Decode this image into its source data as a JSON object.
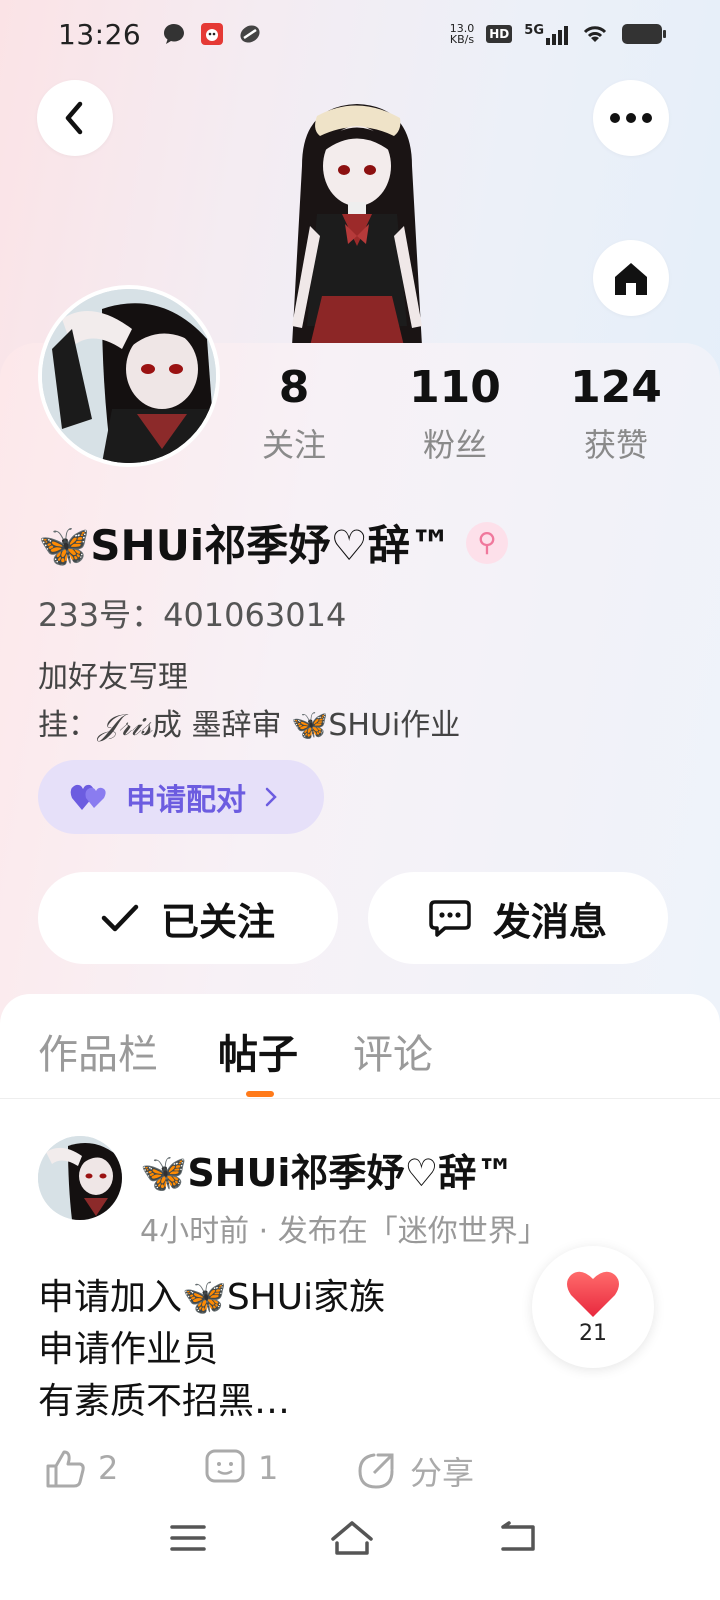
{
  "status_bar": {
    "time": "13:26",
    "net_speed_value": "13.0",
    "net_speed_unit": "KB/s",
    "hd_label": "HD",
    "network_label": "5G"
  },
  "header": {
    "back_icon": "chevron-left-icon",
    "more_icon": "more-dots-icon",
    "home_icon": "home-icon"
  },
  "profile": {
    "stats": [
      {
        "value": "8",
        "label": "关注"
      },
      {
        "value": "110",
        "label": "粉丝"
      },
      {
        "value": "124",
        "label": "获赞"
      }
    ],
    "nickname": "🦋SHUi祁季妤♡辞™",
    "gender_symbol": "⚲",
    "uid": "233号：401063014",
    "bio_line1": "加好友写理",
    "bio_line2_prefix": "挂：",
    "bio_line2_iris": "𝒥𝓇𝒾𝓈",
    "bio_line2_rest": "成 墨辞审 🦋SHUi作业",
    "pair_button": "申请配对",
    "follow_button": "已关注",
    "message_button": "发消息"
  },
  "tabs": [
    {
      "label": "作品栏",
      "active": false
    },
    {
      "label": "帖子",
      "active": true
    },
    {
      "label": "评论",
      "active": false
    }
  ],
  "post": {
    "author": "🦋SHUi祁季妤♡辞™",
    "meta": "4小时前 · 发布在「迷你世界」",
    "body_lines": [
      "申请加入🦋SHUi家族",
      "申请作业员",
      "有素质不招黑…"
    ],
    "like_float_count": "21",
    "actions": {
      "likes": "2",
      "comments": "1",
      "share": "分享"
    }
  },
  "colors": {
    "accent_orange": "#ff7a1a",
    "pair_purple": "#6c5ce0",
    "heart_red": "#f0354a"
  }
}
